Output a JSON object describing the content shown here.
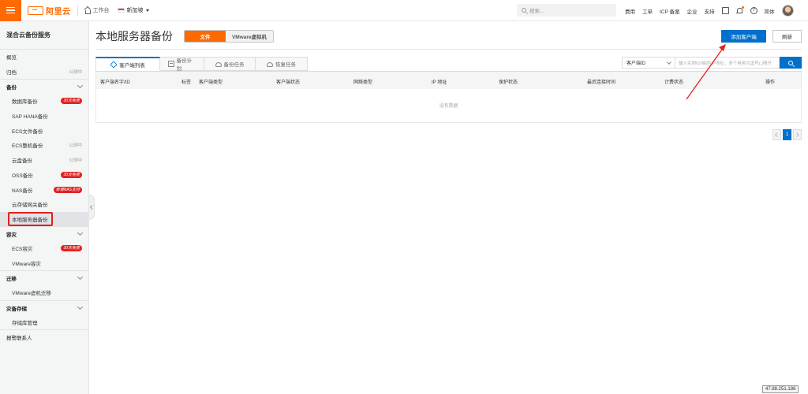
{
  "topbar": {
    "logo_text": "阿里云",
    "workbench": "工作台",
    "region": "新加坡",
    "search_placeholder": "搜索...",
    "links": [
      "费用",
      "工单",
      "ICP 备案",
      "企业",
      "支持"
    ],
    "language": "简体",
    "brand_color": "#ff6a00"
  },
  "sidebar": {
    "title": "混合云备份服务",
    "items": [
      {
        "label": "概览",
        "type": "item"
      },
      {
        "label": "归档",
        "type": "item",
        "tag": "公测中"
      },
      {
        "label": "备份",
        "type": "group"
      },
      {
        "label": "数据库备份",
        "type": "sub",
        "tag": "30天免费"
      },
      {
        "label": "SAP HANA备份",
        "type": "sub"
      },
      {
        "label": "ECS文件备份",
        "type": "sub"
      },
      {
        "label": "ECS整机备份",
        "type": "sub",
        "tag": "公测中"
      },
      {
        "label": "云盘备份",
        "type": "sub",
        "tag": "公测中"
      },
      {
        "label": "OSS备份",
        "type": "sub",
        "tag": "30天免费"
      },
      {
        "label": "NAS备份",
        "type": "sub",
        "tag": "新增NAS支持"
      },
      {
        "label": "云存储网关备份",
        "type": "sub"
      },
      {
        "label": "本地服务器备份",
        "type": "sub",
        "active": true
      },
      {
        "label": "容灾",
        "type": "group"
      },
      {
        "label": "ECS容灾",
        "type": "sub",
        "tag": "30天免费"
      },
      {
        "label": "VMware容灾",
        "type": "sub"
      },
      {
        "label": "迁移",
        "type": "group"
      },
      {
        "label": "VMware虚机迁移",
        "type": "sub"
      },
      {
        "label": "灾备存储",
        "type": "group"
      },
      {
        "label": "存储库管理",
        "type": "sub"
      },
      {
        "label": "报警联系人",
        "type": "item"
      }
    ]
  },
  "main": {
    "page_title": "本地服务器备份",
    "toggle": {
      "active": "文件",
      "inactive": "VMware虚拟机"
    },
    "add_client_label": "添加客户端",
    "refresh_label": "刷新",
    "tabs": [
      "客户端列表",
      "备份计划",
      "备份任务",
      "恢复任务"
    ],
    "filter": {
      "select_value": "客户端ID",
      "input_placeholder": "输入实例ID/描述/IP地址，多个用英文逗号(,)隔开"
    },
    "table": {
      "columns": [
        "客户端名字/ID",
        "标签",
        "客户端类型",
        "客户端状态",
        "网络类型",
        "IP 地址",
        "保护状态",
        "最后连接时间",
        "计费状态",
        "操作"
      ],
      "empty_text": "没有数据"
    },
    "pagination": {
      "current_page": "1"
    }
  },
  "footer": {
    "ip": "47.88.251.186"
  },
  "annotation_color": "#e02020"
}
